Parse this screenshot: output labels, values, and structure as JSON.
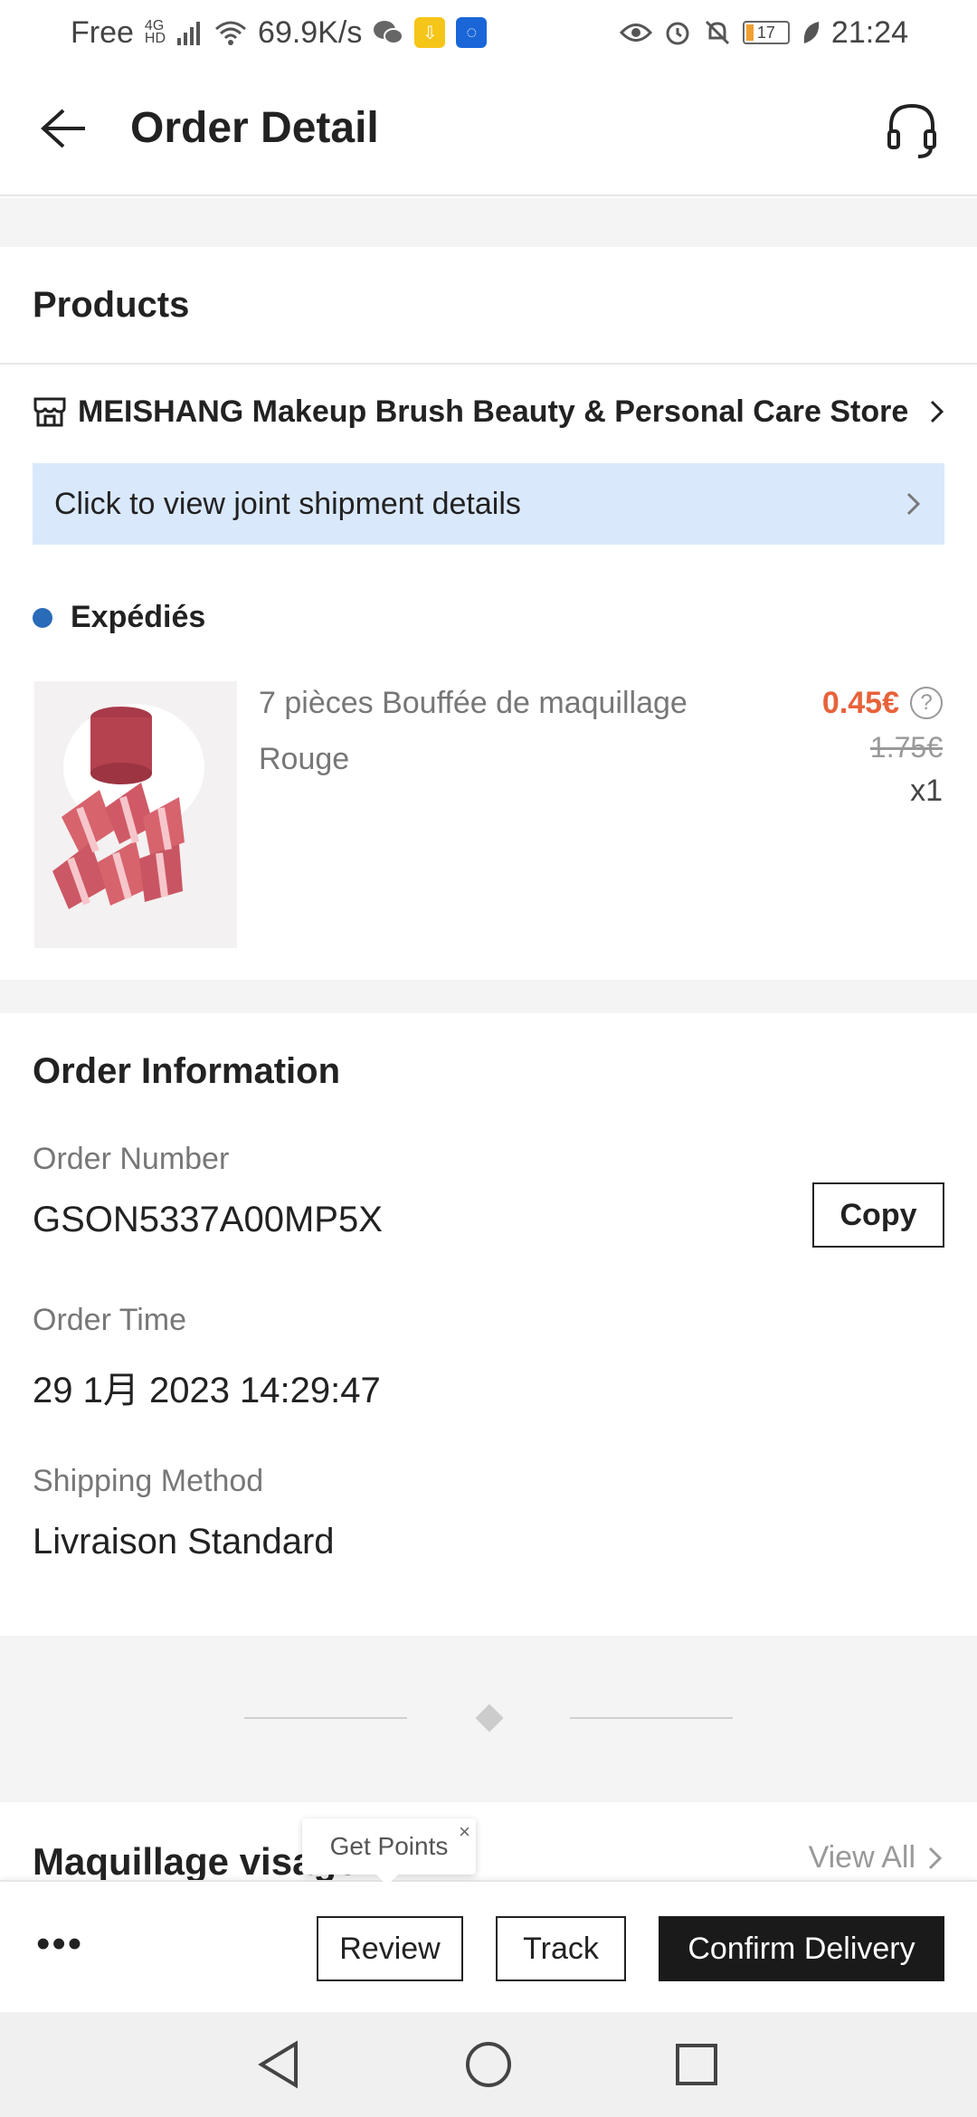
{
  "status_bar": {
    "carrier": "Free",
    "network_top": "4G",
    "network_bottom": "HD",
    "speed": "69.9K/s",
    "battery_level": "17",
    "time": "21:24"
  },
  "header": {
    "title": "Order Detail"
  },
  "products": {
    "section_title": "Products",
    "store_name": "MEISHANG Makeup Brush Beauty & Personal Care Store",
    "shipment_banner": "Click to view joint shipment details",
    "status": "Expédiés",
    "item": {
      "name": "7 pièces Bouffée de maquillage",
      "variant": "Rouge",
      "price": "0.45€",
      "original_price": "1.75€",
      "quantity": "x1"
    }
  },
  "order_info": {
    "section_title": "Order Information",
    "order_number_label": "Order Number",
    "order_number": "GSON5337A00MP5X",
    "copy_label": "Copy",
    "order_time_label": "Order Time",
    "order_time": "29 1月 2023 14:29:47",
    "shipping_method_label": "Shipping Method",
    "shipping_method": "Livraison Standard"
  },
  "recommendations": {
    "title": "Maquillage visage",
    "view_all": "View All",
    "tooltip": "Get Points"
  },
  "actions": {
    "more": "•••",
    "review": "Review",
    "track": "Track",
    "confirm": "Confirm Delivery"
  },
  "colors": {
    "price": "#e8623a",
    "banner": "#d9e8fb",
    "status_dot": "#2a6bb8",
    "primary_button": "#1a1a1a"
  }
}
